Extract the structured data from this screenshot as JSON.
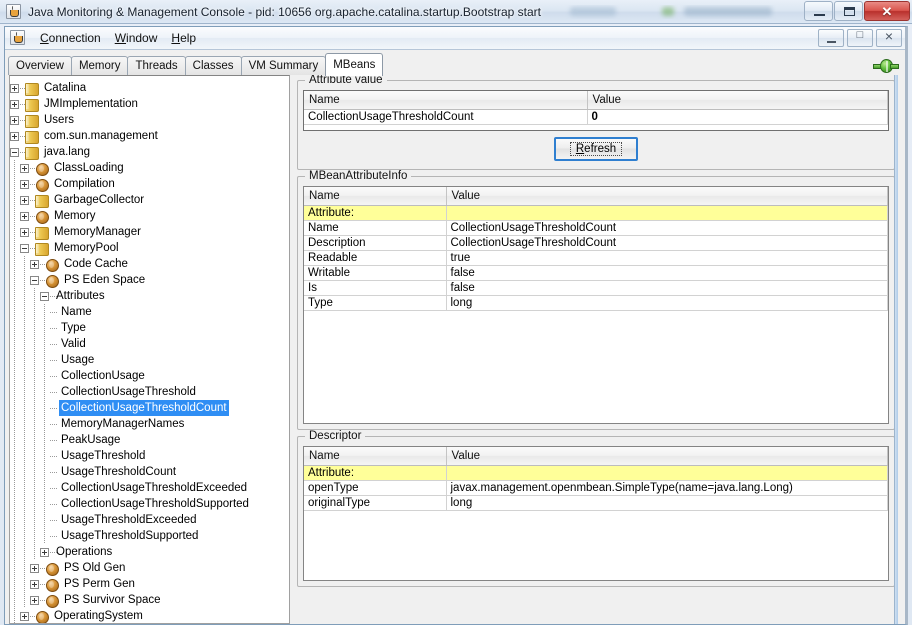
{
  "window": {
    "title": "Java Monitoring & Management Console - pid: 10656 org.apache.catalina.startup.Bootstrap start",
    "icon": "java-cup-icon",
    "buttons": {
      "minimize": "minimize-icon",
      "maximize": "maximize-icon",
      "close": "close-icon"
    }
  },
  "inner_window": {
    "icon": "java-cup-icon",
    "menu": [
      {
        "label": "Connection",
        "mnemonic": "C"
      },
      {
        "label": "Window",
        "mnemonic": "W"
      },
      {
        "label": "Help",
        "mnemonic": "H"
      }
    ],
    "buttons": {
      "minimize": "minimize-icon",
      "restore": "restore-icon",
      "close": "close-icon"
    }
  },
  "tabs": {
    "items": [
      "Overview",
      "Memory",
      "Threads",
      "Classes",
      "VM Summary",
      "MBeans"
    ],
    "active": "MBeans",
    "status_icon": "connected-plug-icon"
  },
  "tree": {
    "nodes": [
      {
        "label": "Catalina",
        "depth": 0,
        "icon": "folder-icon",
        "state": "collapsed"
      },
      {
        "label": "JMImplementation",
        "depth": 0,
        "icon": "folder-icon",
        "state": "collapsed"
      },
      {
        "label": "Users",
        "depth": 0,
        "icon": "folder-icon",
        "state": "collapsed"
      },
      {
        "label": "com.sun.management",
        "depth": 0,
        "icon": "folder-icon",
        "state": "collapsed"
      },
      {
        "label": "java.lang",
        "depth": 0,
        "icon": "folder-icon",
        "state": "expanded"
      },
      {
        "label": "ClassLoading",
        "depth": 1,
        "icon": "mbean-icon",
        "state": "collapsed"
      },
      {
        "label": "Compilation",
        "depth": 1,
        "icon": "mbean-icon",
        "state": "collapsed"
      },
      {
        "label": "GarbageCollector",
        "depth": 1,
        "icon": "folder-icon",
        "state": "collapsed"
      },
      {
        "label": "Memory",
        "depth": 1,
        "icon": "mbean-icon",
        "state": "collapsed"
      },
      {
        "label": "MemoryManager",
        "depth": 1,
        "icon": "folder-icon",
        "state": "collapsed"
      },
      {
        "label": "MemoryPool",
        "depth": 1,
        "icon": "folder-icon",
        "state": "expanded"
      },
      {
        "label": "Code Cache",
        "depth": 2,
        "icon": "mbean-icon",
        "state": "collapsed"
      },
      {
        "label": "PS Eden Space",
        "depth": 2,
        "icon": "mbean-icon",
        "state": "expanded"
      },
      {
        "label": "Attributes",
        "depth": 3,
        "icon": "none",
        "state": "expanded"
      },
      {
        "label": "Name",
        "depth": 4,
        "icon": "none",
        "state": "leaf"
      },
      {
        "label": "Type",
        "depth": 4,
        "icon": "none",
        "state": "leaf"
      },
      {
        "label": "Valid",
        "depth": 4,
        "icon": "none",
        "state": "leaf"
      },
      {
        "label": "Usage",
        "depth": 4,
        "icon": "none",
        "state": "leaf"
      },
      {
        "label": "CollectionUsage",
        "depth": 4,
        "icon": "none",
        "state": "leaf"
      },
      {
        "label": "CollectionUsageThreshold",
        "depth": 4,
        "icon": "none",
        "state": "leaf"
      },
      {
        "label": "CollectionUsageThresholdCount",
        "depth": 4,
        "icon": "none",
        "state": "leaf",
        "selected": true
      },
      {
        "label": "MemoryManagerNames",
        "depth": 4,
        "icon": "none",
        "state": "leaf"
      },
      {
        "label": "PeakUsage",
        "depth": 4,
        "icon": "none",
        "state": "leaf"
      },
      {
        "label": "UsageThreshold",
        "depth": 4,
        "icon": "none",
        "state": "leaf"
      },
      {
        "label": "UsageThresholdCount",
        "depth": 4,
        "icon": "none",
        "state": "leaf"
      },
      {
        "label": "CollectionUsageThresholdExceeded",
        "depth": 4,
        "icon": "none",
        "state": "leaf"
      },
      {
        "label": "CollectionUsageThresholdSupported",
        "depth": 4,
        "icon": "none",
        "state": "leaf"
      },
      {
        "label": "UsageThresholdExceeded",
        "depth": 4,
        "icon": "none",
        "state": "leaf"
      },
      {
        "label": "UsageThresholdSupported",
        "depth": 4,
        "icon": "none",
        "state": "leaf"
      },
      {
        "label": "Operations",
        "depth": 3,
        "icon": "none",
        "state": "collapsed"
      },
      {
        "label": "PS Old Gen",
        "depth": 2,
        "icon": "mbean-icon",
        "state": "collapsed"
      },
      {
        "label": "PS Perm Gen",
        "depth": 2,
        "icon": "mbean-icon",
        "state": "collapsed"
      },
      {
        "label": "PS Survivor Space",
        "depth": 2,
        "icon": "mbean-icon",
        "state": "collapsed"
      },
      {
        "label": "OperatingSystem",
        "depth": 1,
        "icon": "mbean-icon",
        "state": "collapsed"
      }
    ]
  },
  "attribute_value": {
    "legend": "Attribute value",
    "columns": [
      "Name",
      "Value"
    ],
    "rows": [
      {
        "name": "CollectionUsageThresholdCount",
        "value": "0"
      }
    ],
    "refresh_label": "Refresh",
    "refresh_mnemonic": "R"
  },
  "mbean_attribute_info": {
    "legend": "MBeanAttributeInfo",
    "columns": [
      "Name",
      "Value"
    ],
    "rows": [
      {
        "name": "Attribute:",
        "value": "",
        "header": true
      },
      {
        "name": "Name",
        "value": "CollectionUsageThresholdCount"
      },
      {
        "name": "Description",
        "value": "CollectionUsageThresholdCount"
      },
      {
        "name": "Readable",
        "value": "true"
      },
      {
        "name": "Writable",
        "value": "false"
      },
      {
        "name": "Is",
        "value": "false"
      },
      {
        "name": "Type",
        "value": "long"
      }
    ]
  },
  "descriptor": {
    "legend": "Descriptor",
    "columns": [
      "Name",
      "Value"
    ],
    "rows": [
      {
        "name": "Attribute:",
        "value": "",
        "header": true
      },
      {
        "name": "openType",
        "value": "javax.management.openmbean.SimpleType(name=java.lang.Long)"
      },
      {
        "name": "originalType",
        "value": "long"
      }
    ]
  },
  "colors": {
    "selection": "#2f8ef4",
    "highlight_row": "#ffff99",
    "titlebar_close": "#d9544c",
    "status_led": "#5fbc3a"
  }
}
